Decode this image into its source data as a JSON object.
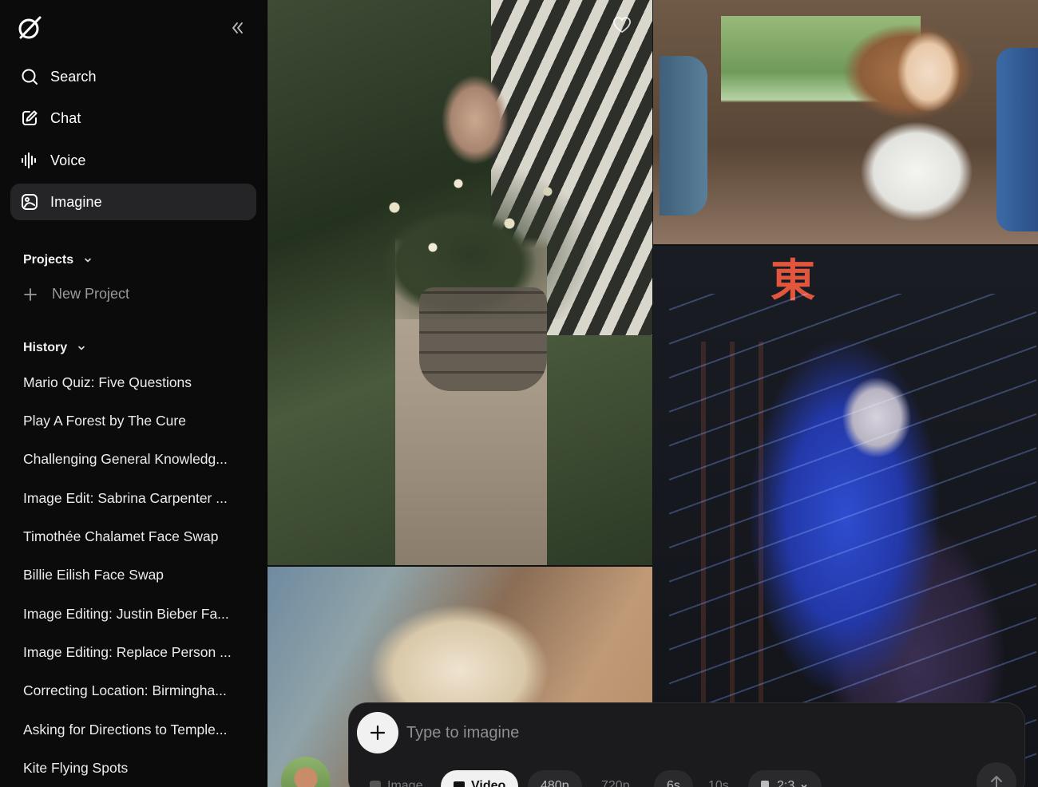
{
  "sidebar": {
    "nav": [
      {
        "label": "Search",
        "icon": "search-icon"
      },
      {
        "label": "Chat",
        "icon": "edit-icon"
      },
      {
        "label": "Voice",
        "icon": "waveform-icon"
      },
      {
        "label": "Imagine",
        "icon": "imagine-icon",
        "active": true
      }
    ],
    "projects": {
      "title": "Projects",
      "new_label": "New Project"
    },
    "history": {
      "title": "History",
      "items": [
        "Mario Quiz: Five Questions",
        "Play A Forest by The Cure",
        "Challenging General Knowledg...",
        "Image Edit: Sabrina Carpenter ...",
        "Timothée Chalamet Face Swap",
        "Billie Eilish Face Swap",
        "Image Editing: Justin Bieber Fa...",
        "Image Editing: Replace Person ...",
        "Correcting Location: Birmingha...",
        "Asking for Directions to Temple...",
        "Kite Flying Spots"
      ]
    }
  },
  "gallery": {
    "sign_text": "東"
  },
  "prompt": {
    "placeholder": "Type to imagine",
    "chips": [
      "Image",
      "Video",
      "480p",
      "720p",
      "6s",
      "10s",
      "2:3"
    ],
    "active_mode": "Video"
  },
  "colors": {
    "sidebar_bg": "#0b0b0c",
    "active_nav_bg": "#252527",
    "prompt_bg": "#1b1b1d"
  }
}
